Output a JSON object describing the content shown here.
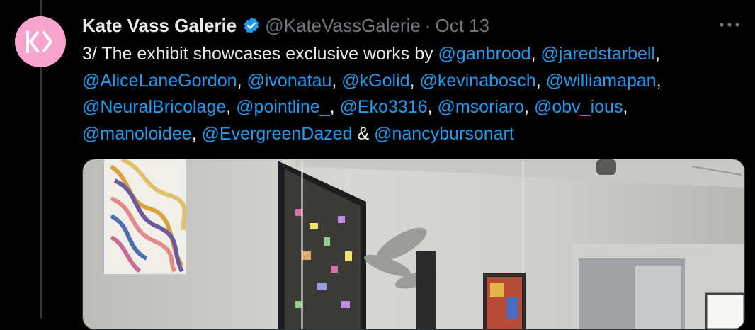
{
  "tweet": {
    "avatar_icon": "kate-vass-logo-icon",
    "display_name": "Kate Vass Galerie",
    "verified_icon": "verified-badge-icon",
    "handle": "@KateVassGalerie",
    "separator": "·",
    "date": "Oct 13",
    "more_icon": "more-options-icon",
    "text_segments": [
      {
        "text": "3/ The exhibit showcases exclusive works by ",
        "type": "text"
      },
      {
        "text": "@ganbrood",
        "type": "mention"
      },
      {
        "text": ", ",
        "type": "text"
      },
      {
        "text": "@jaredstarbell",
        "type": "mention"
      },
      {
        "text": ",\n",
        "type": "text"
      },
      {
        "text": "@AliceLaneGordon",
        "type": "mention"
      },
      {
        "text": ", ",
        "type": "text"
      },
      {
        "text": "@ivonatau",
        "type": "mention"
      },
      {
        "text": ", ",
        "type": "text"
      },
      {
        "text": "@kGolid",
        "type": "mention"
      },
      {
        "text": ", ",
        "type": "text"
      },
      {
        "text": "@kevinabosch",
        "type": "mention"
      },
      {
        "text": ", ",
        "type": "text"
      },
      {
        "text": "@williamapan",
        "type": "mention"
      },
      {
        "text": ",\n",
        "type": "text"
      },
      {
        "text": "@NeuralBricolage",
        "type": "mention"
      },
      {
        "text": ", ",
        "type": "text"
      },
      {
        "text": "@pointline_",
        "type": "mention"
      },
      {
        "text": ", ",
        "type": "text"
      },
      {
        "text": "@Eko3316",
        "type": "mention"
      },
      {
        "text": ", ",
        "type": "text"
      },
      {
        "text": "@msoriaro",
        "type": "mention"
      },
      {
        "text": ", ",
        "type": "text"
      },
      {
        "text": "@obv_ious",
        "type": "mention"
      },
      {
        "text": ",\n",
        "type": "text"
      },
      {
        "text": "@manoloidee",
        "type": "mention"
      },
      {
        "text": ", ",
        "type": "text"
      },
      {
        "text": "@EvergreenDazed",
        "type": "mention"
      },
      {
        "text": " & ",
        "type": "text"
      },
      {
        "text": "@nancybursonart",
        "type": "mention"
      }
    ],
    "media_icon": "gallery-exhibition-photo"
  },
  "colors": {
    "background": "#000000",
    "text": "#e7e9ea",
    "secondary_text": "#71767b",
    "accent": "#1d9bf0",
    "avatar_bg": "#f9a3cf"
  }
}
